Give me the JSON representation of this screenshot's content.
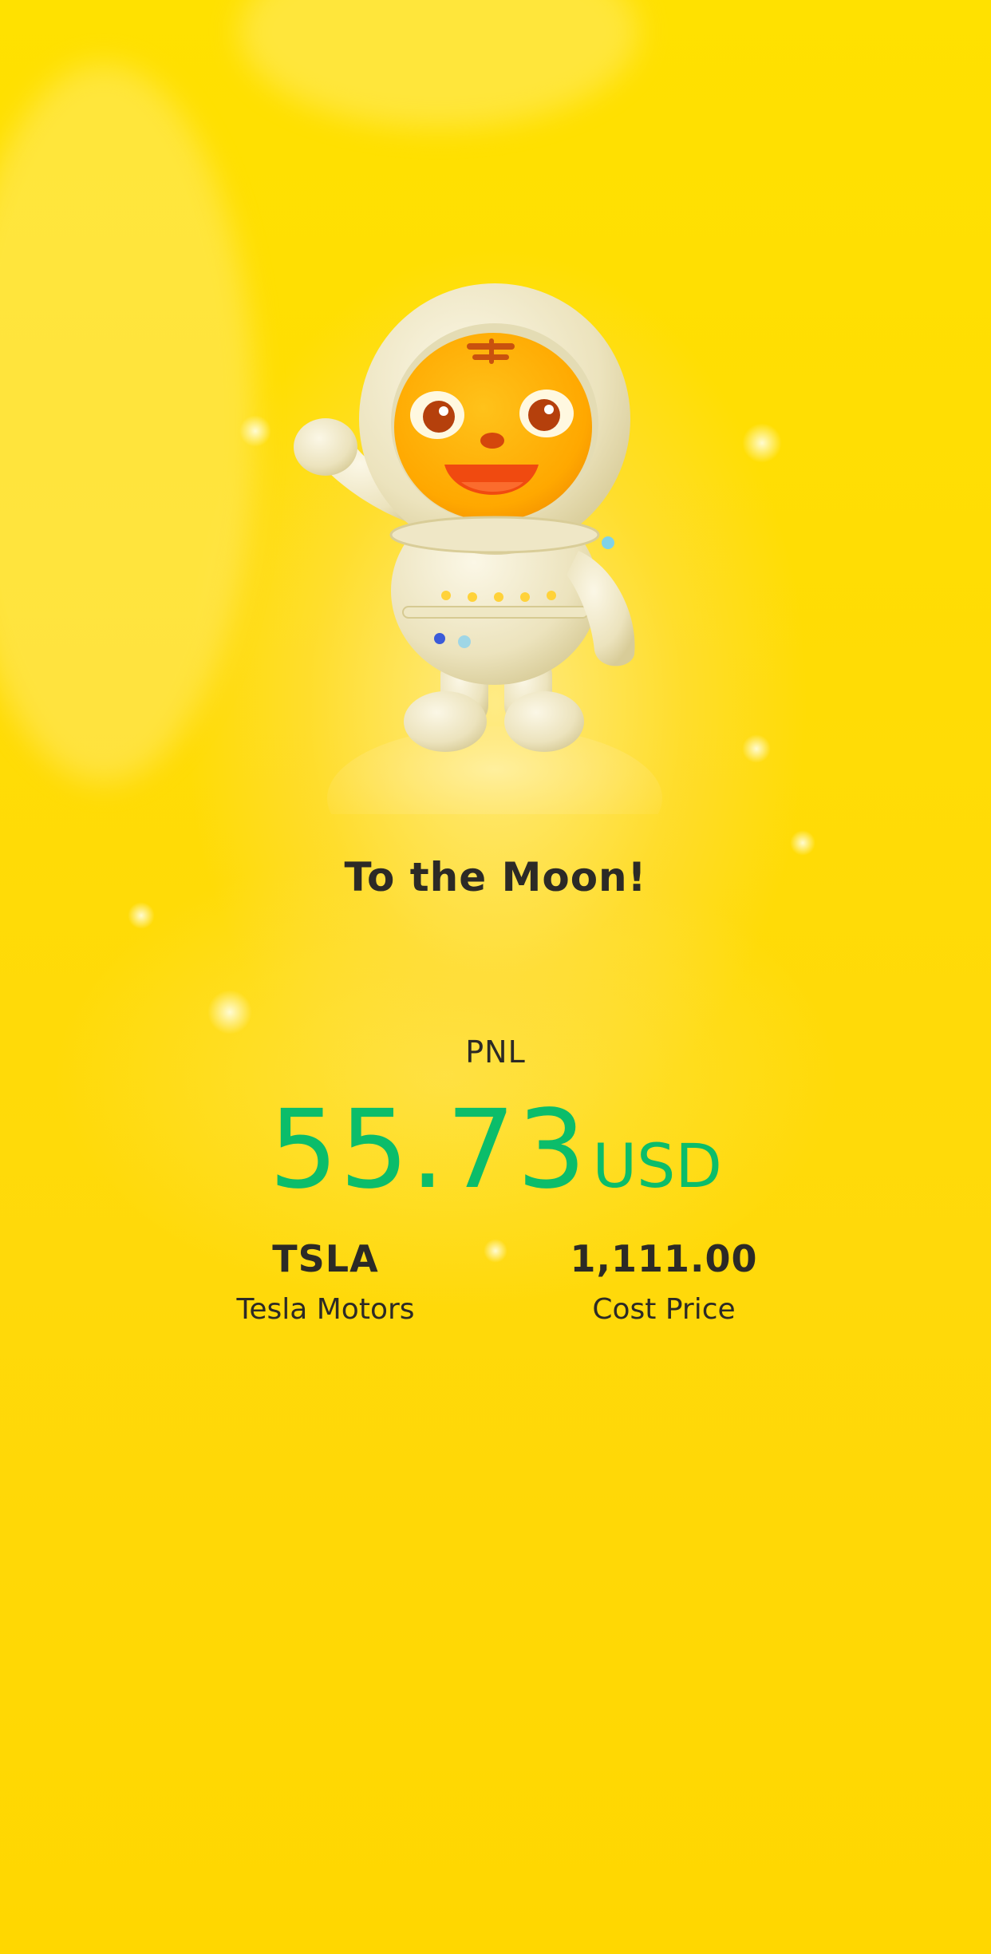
{
  "card": {
    "headline": "To the Moon!",
    "pnl_label": "PNL",
    "pnl_value": "55.73",
    "pnl_unit": "USD",
    "symbol": "TSLA",
    "company": "Tesla Motors",
    "cost_price": "1,111.00",
    "cost_label": "Cost Price"
  },
  "colors": {
    "background": "#ffdc05",
    "text": "#2c2a26",
    "profit": "#0bbd6a"
  },
  "illustration": {
    "icon": "astronaut-tiger-mascot-icon"
  }
}
